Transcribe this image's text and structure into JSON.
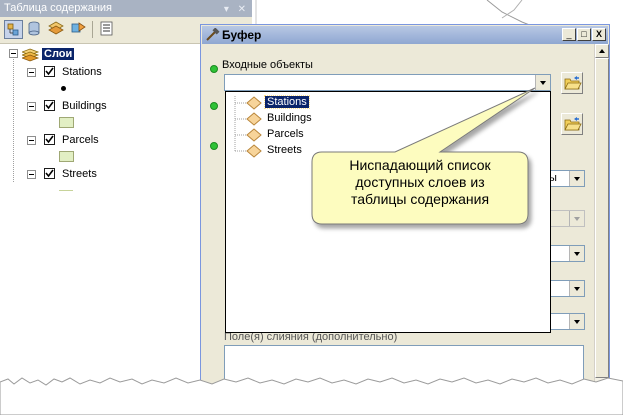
{
  "toc": {
    "title": "Таблица содержания",
    "title_buttons": "▾ ✕",
    "group_label": "Слои",
    "layers": [
      {
        "name": "Stations"
      },
      {
        "name": "Buildings"
      },
      {
        "name": "Parcels"
      },
      {
        "name": "Streets"
      }
    ]
  },
  "dialog": {
    "title": "Буфер",
    "window_buttons": {
      "minimize": "_",
      "maximize": "□",
      "close": "X"
    },
    "input_label": "Входные объекты",
    "input_value": "",
    "dissolve_fields_label": "Поле(я) слияния (дополнительно)",
    "partial_combo_text": "ы"
  },
  "dropdown": {
    "items": [
      "Stations",
      "Buildings",
      "Parcels",
      "Streets"
    ],
    "selected": "Stations"
  },
  "callout": {
    "line1": "Ниспадающий список",
    "line2": "доступных слоев из",
    "line3": "таблицы содержания"
  },
  "colors": {
    "selection": "#0a246a",
    "callout_fill": "#fdfcbf",
    "dialog_bg": "#ece9d8",
    "green_dot": "#2fc236",
    "layer_symbol": "#e2efc4"
  }
}
